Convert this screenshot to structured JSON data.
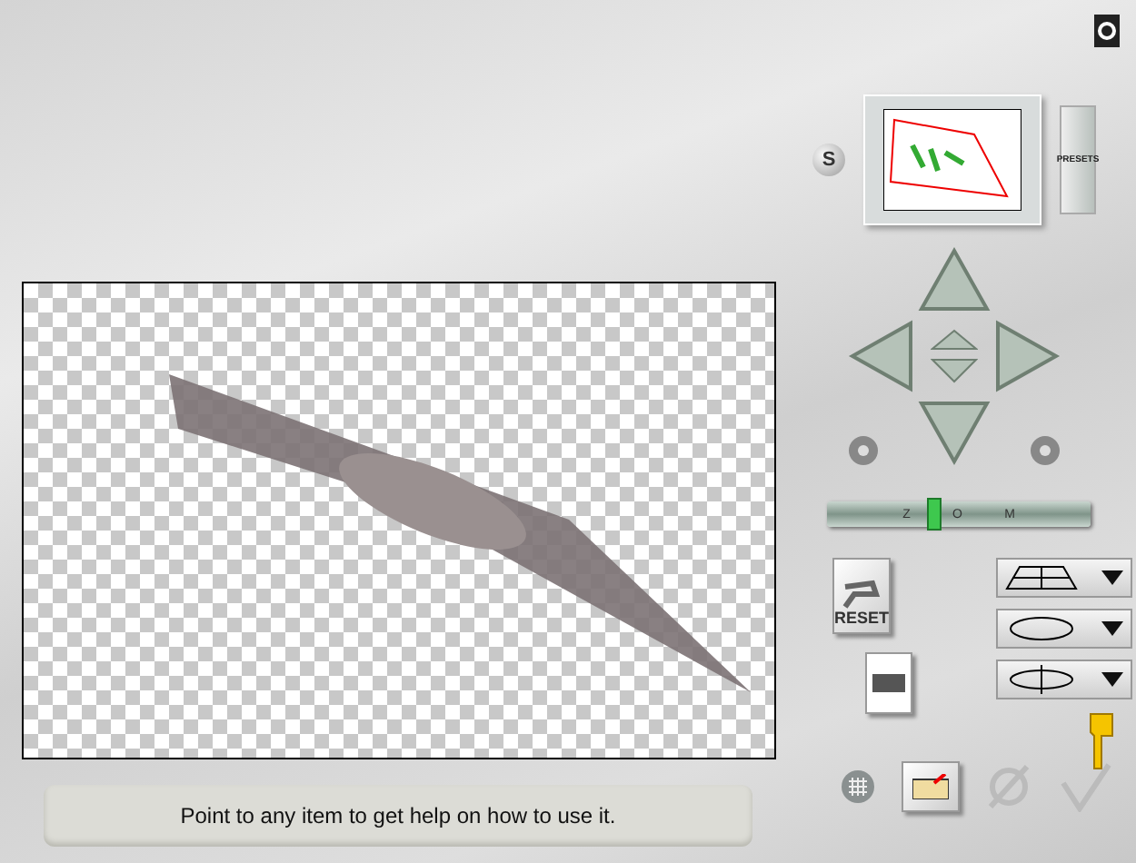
{
  "preview": {
    "style_button": "S",
    "presets_button": "PRESETS"
  },
  "zoom": {
    "labels": [
      "Z",
      "O",
      "M"
    ],
    "level": 0.4
  },
  "reset_button": "RESET",
  "status_bar": {
    "help": "Point to any item to get help on how to use it."
  }
}
